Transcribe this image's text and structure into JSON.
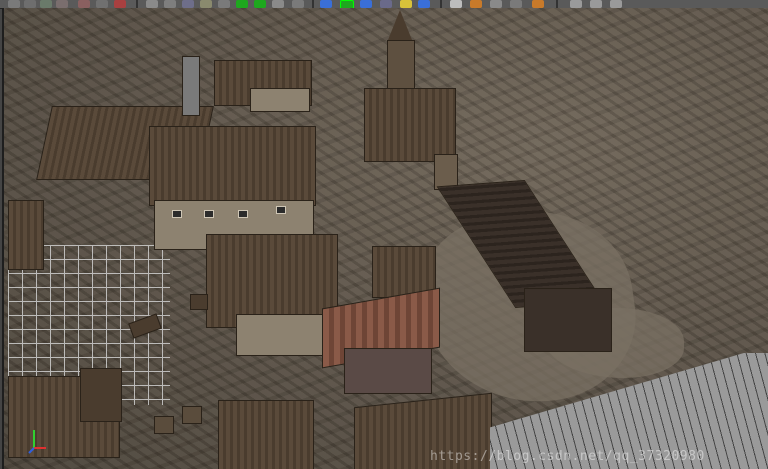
{
  "toolbar": {
    "buttons": [
      "select-tool",
      "move-tool",
      "rotate-tool",
      "scale-tool",
      "paint-tool",
      "snap-tool",
      "render-tool",
      "display-tool",
      "graph-tool",
      "hypershade-tool",
      "light-tool",
      "camera-tool",
      "sphere-tool",
      "cube-tool",
      "material-tool",
      "xray-tool",
      "wireframe-tool",
      "shaded-tool",
      "isolate-tool",
      "grid-tool",
      "panel-tool"
    ],
    "colors": {
      "bar": "#5a5a5a",
      "accent_green": "#1ea81e",
      "accent_blue": "#3a6fd8",
      "accent_yellow": "#d8c23a"
    }
  },
  "viewport": {
    "scene": "3d-medieval-village",
    "watermark": "https://blog.csdn.net/qq_37320980"
  },
  "gizmo": {
    "axes": [
      "x",
      "y",
      "z"
    ],
    "colors": {
      "x": "#e03030",
      "y": "#30d030",
      "z": "#3060e0"
    }
  }
}
